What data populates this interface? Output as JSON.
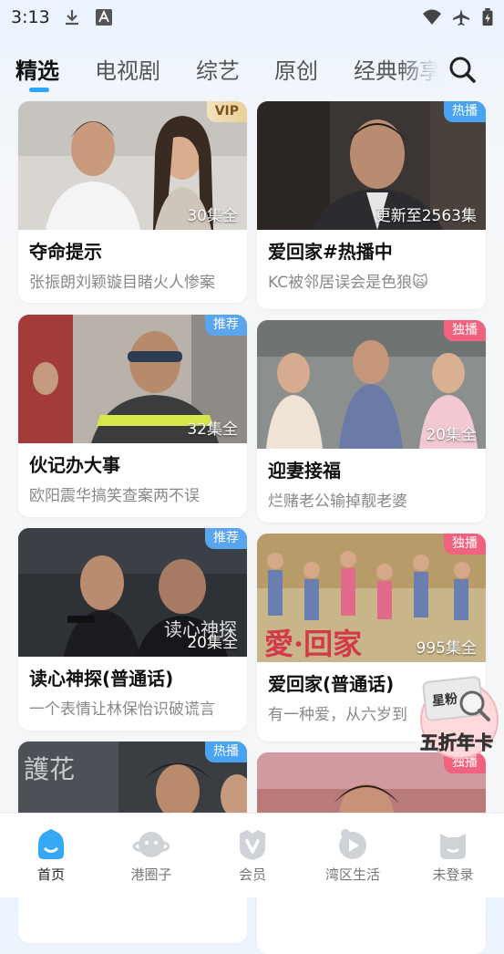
{
  "status_bar": {
    "time": "3:13",
    "icons": [
      "download-icon",
      "font-a-icon",
      "wifi-icon",
      "airplane-icon",
      "battery-icon"
    ]
  },
  "tabs": [
    {
      "label": "精选",
      "active": true
    },
    {
      "label": "电视剧",
      "active": false
    },
    {
      "label": "综艺",
      "active": false
    },
    {
      "label": "原创",
      "active": false
    },
    {
      "label": "经典畅享",
      "active": false
    }
  ],
  "cards": [
    {
      "title": "夺命提示",
      "subtitle": "张振朗刘颖镟目睹火人惨案",
      "badge": "VIP",
      "episodes": "30集全"
    },
    {
      "title": "爱回家#热播中",
      "subtitle": "KC被邻居误会是色狼🙀",
      "badge": "热播",
      "episodes": "更新至2563集"
    },
    {
      "title": "伙记办大事",
      "subtitle": "欧阳震华搞笑查案两不误",
      "badge": "推荐",
      "episodes": "32集全"
    },
    {
      "title": "迎妻接福",
      "subtitle": "烂赌老公输掉靓老婆",
      "badge": "独播",
      "episodes": "20集全"
    },
    {
      "title": "读心神探(普通话)",
      "subtitle": "一个表情让林保怡识破谎言",
      "badge": "推荐",
      "episodes": "20集全"
    },
    {
      "title": "爱回家(普通话)",
      "subtitle": "有一种爱，从六岁到",
      "badge": "独播",
      "episodes": "995集全"
    },
    {
      "badge": "热播"
    },
    {
      "badge": "独播"
    }
  ],
  "promo": {
    "text": "五折年卡",
    "icon": "annual-card-promo-icon"
  },
  "bottom_nav": [
    {
      "label": "首页",
      "icon": "home-icon",
      "active": true
    },
    {
      "label": "港圈子",
      "icon": "planet-icon",
      "active": false
    },
    {
      "label": "会员",
      "icon": "vip-shield-icon",
      "active": false
    },
    {
      "label": "湾区生活",
      "icon": "play-video-icon",
      "active": false
    },
    {
      "label": "未登录",
      "icon": "user-cat-icon",
      "active": false
    }
  ],
  "colors": {
    "accent": "#2aa6ff",
    "vip_gold": "#e9cf98",
    "hot_blue": "#4aa3f0",
    "exclusive_pink": "#f0627e"
  }
}
